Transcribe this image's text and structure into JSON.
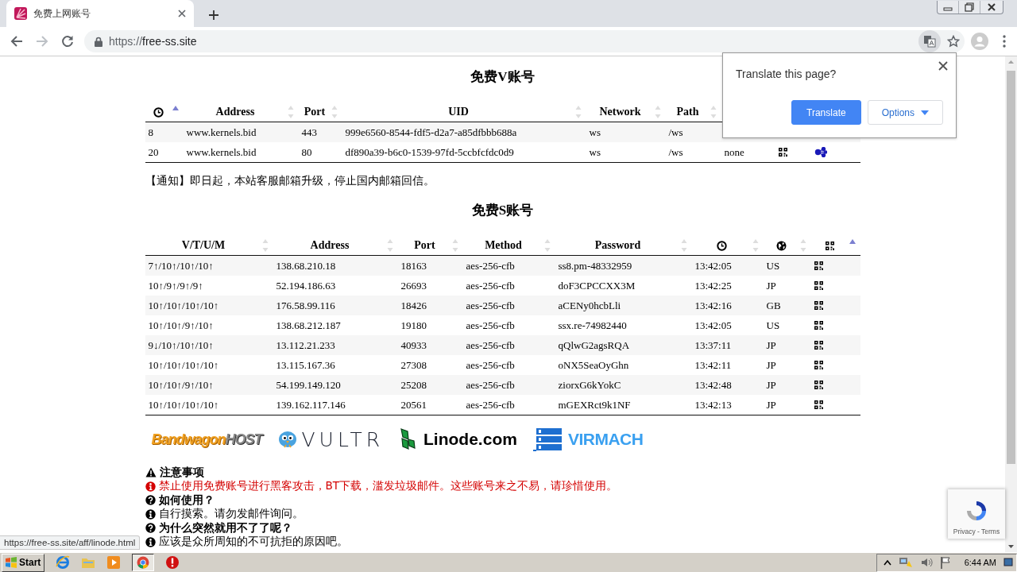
{
  "browser": {
    "tab": {
      "title": "免费上网账号"
    },
    "url": {
      "scheme": "https://",
      "host": "free-ss.site"
    }
  },
  "translate_popup": {
    "title": "Translate this page?",
    "buttons": [
      {
        "label": "Translate",
        "kind": "primary"
      },
      {
        "label": "Options",
        "kind": "menu"
      }
    ]
  },
  "v_section": {
    "title": "免费V账号",
    "table": {
      "columns": [
        {
          "kind": "time",
          "sorted": true
        },
        {
          "kind": "text",
          "label": "Address",
          "sorted": false
        },
        {
          "kind": "text",
          "label": "Port",
          "sorted": false
        },
        {
          "kind": "text",
          "label": "UID",
          "sorted": false
        },
        {
          "kind": "text",
          "label": "Network",
          "sorted": false
        },
        {
          "kind": "text",
          "label": "Path",
          "sorted": false
        }
      ],
      "rows": [
        {
          "cells": [
            "8",
            "www.kernels.bid",
            "443",
            "999e6560-8544-fdf5-d2a7-a85dfbbb688a",
            "ws",
            "/ws"
          ]
        },
        {
          "cells": [
            "20",
            "www.kernels.bid",
            "80",
            "df890a39-b6c0-1539-97fd-5ccbfcfdc0d9",
            "ws",
            "/ws",
            "none",
            {
              "kind": "qr"
            },
            {
              "kind": "share"
            }
          ]
        }
      ]
    }
  },
  "notice": "【通知】即日起，本站客服邮箱升级，停止国内邮箱回信。",
  "s_section": {
    "title": "免费S账号",
    "table": {
      "columns": [
        {
          "kind": "text",
          "label": "V/T/U/M",
          "sorted": false
        },
        {
          "kind": "text",
          "label": "Address",
          "sorted": false
        },
        {
          "kind": "text",
          "label": "Port",
          "sorted": false
        },
        {
          "kind": "text",
          "label": "Method",
          "sorted": false
        },
        {
          "kind": "text",
          "label": "Password",
          "sorted": false
        },
        {
          "kind": "time",
          "sorted": false
        },
        {
          "kind": "region",
          "sorted": false
        },
        {
          "kind": "qrcode",
          "sorted": true
        }
      ],
      "rows": [
        {
          "cells": [
            "7↑/10↑/10↑/10↑",
            "138.68.210.18",
            "18163",
            "aes-256-cfb",
            "ss8.pm-48332959",
            "13:42:05",
            "US",
            {
              "kind": "qr"
            }
          ]
        },
        {
          "cells": [
            "10↑/9↑/9↑/9↑",
            "52.194.186.63",
            "26693",
            "aes-256-cfb",
            "doF3CPCCXX3M",
            "13:42:25",
            "JP",
            {
              "kind": "qr"
            }
          ]
        },
        {
          "cells": [
            "10↑/10↑/10↑/10↑",
            "176.58.99.116",
            "18426",
            "aes-256-cfb",
            "aCENy0hcbLli",
            "13:42:16",
            "GB",
            {
              "kind": "qr"
            }
          ]
        },
        {
          "cells": [
            "10↑/10↑/9↑/10↑",
            "138.68.212.187",
            "19180",
            "aes-256-cfb",
            "ssx.re-74982440",
            "13:42:05",
            "US",
            {
              "kind": "qr"
            }
          ]
        },
        {
          "cells": [
            "9↓/10↑/10↑/10↑",
            "13.112.21.233",
            "40933",
            "aes-256-cfb",
            "qQlwG2agsRQA",
            "13:37:11",
            "JP",
            {
              "kind": "qr"
            }
          ]
        },
        {
          "cells": [
            "10↑/10↑/10↑/10↑",
            "13.115.167.36",
            "27308",
            "aes-256-cfb",
            "oNX5SeaOyGhn",
            "13:42:11",
            "JP",
            {
              "kind": "qr"
            }
          ]
        },
        {
          "cells": [
            "10↑/10↑/9↑/10↑",
            "54.199.149.120",
            "25208",
            "aes-256-cfb",
            "ziorxG6kYokC",
            "13:42:48",
            "JP",
            {
              "kind": "qr"
            }
          ]
        },
        {
          "cells": [
            "10↑/10↑/10↑/10↑",
            "139.162.117.146",
            "20561",
            "aes-256-cfb",
            "mGEXRct9k1NF",
            "13:42:13",
            "JP",
            {
              "kind": "qr"
            }
          ]
        }
      ]
    }
  },
  "sponsors": [
    {
      "kind": "bandwagon",
      "text": "Bandwagon",
      "accent": "HOST"
    },
    {
      "kind": "vultr",
      "text": "VULTR"
    },
    {
      "kind": "linode",
      "text": "Linode.com"
    },
    {
      "kind": "virmach",
      "text": "VIRMACH"
    }
  ],
  "notes": [
    {
      "kind": "caution",
      "text": "注意事项"
    },
    {
      "kind": "alert",
      "text": "禁止使用免费账号进行黑客攻击，BT下载，滥发垃圾邮件。这些账号来之不易，请珍惜使用。"
    },
    {
      "kind": "question",
      "text": "如何使用？"
    },
    {
      "kind": "info",
      "text": "自行摸索。请勿发邮件询问。"
    },
    {
      "kind": "question",
      "text": "为什么突然就用不了了呢？"
    },
    {
      "kind": "info",
      "text": "应该是众所周知的不可抗拒的原因吧。"
    }
  ],
  "status_link": "https://free-ss.site/aff/linode.html",
  "recaptcha": {
    "links": "Privacy - Terms"
  },
  "taskbar": {
    "start": "Start",
    "clock": "6:44 AM"
  }
}
